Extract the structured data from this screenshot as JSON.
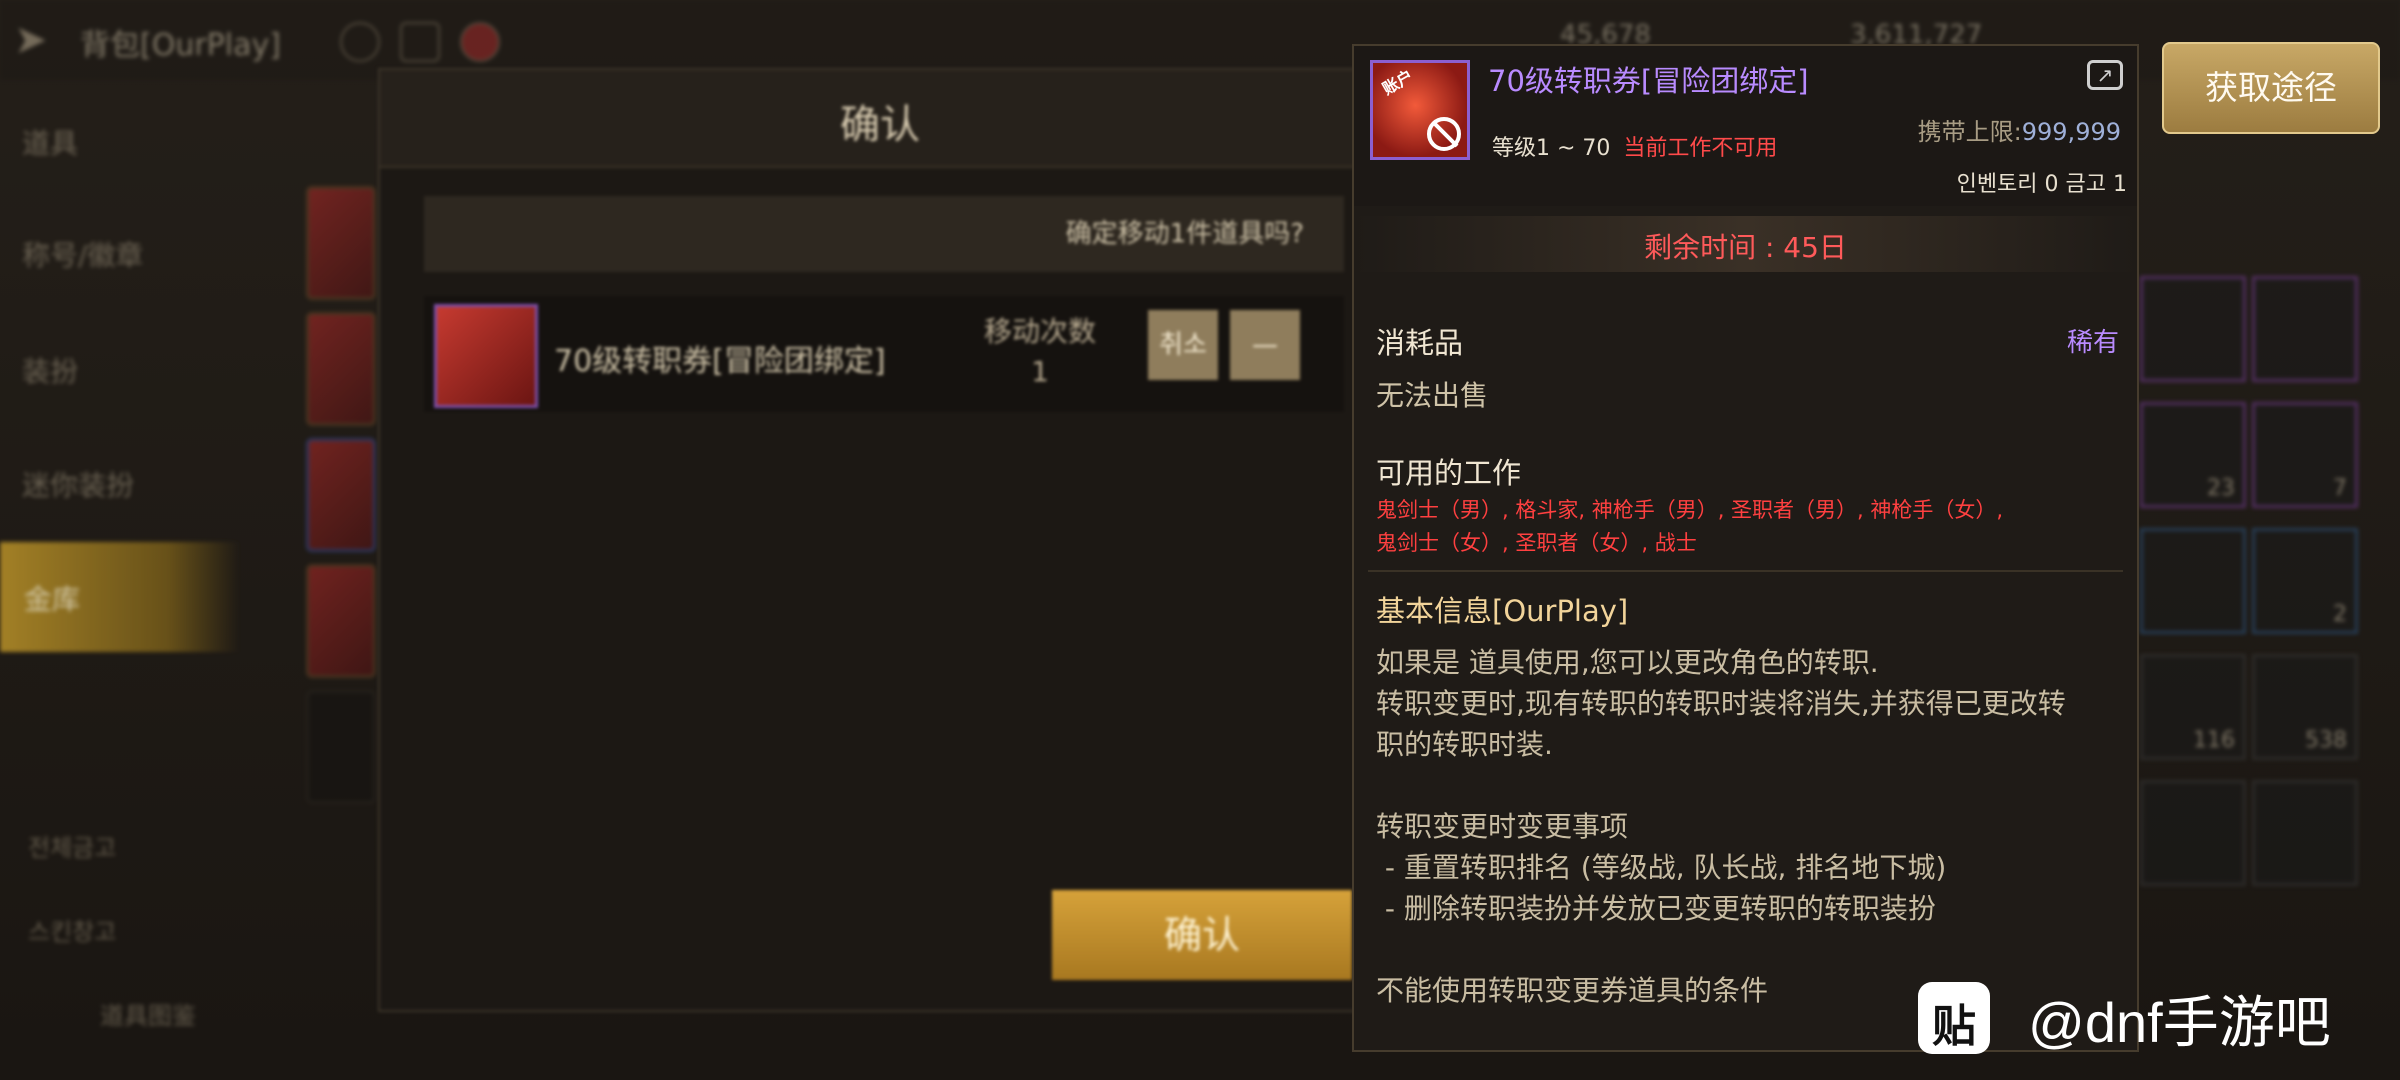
{
  "topbar": {
    "back_icon": "back-arrow-icon",
    "title": "背包[OurPlay]",
    "gold_value": "45,678",
    "cera_value": "3,611,727"
  },
  "sidebar": {
    "items": [
      {
        "label": "道具"
      },
      {
        "label": "称号/徽章"
      },
      {
        "label": "装扮"
      },
      {
        "label": "迷你装扮"
      },
      {
        "label": "金库"
      }
    ],
    "bottom": [
      {
        "label": "전체금고",
        "icon": "vault-icon"
      },
      {
        "label": "스킨창고",
        "icon": "skin-storage-icon"
      },
      {
        "label": "道具图鉴",
        "icon": "codex-icon"
      }
    ]
  },
  "dialog": {
    "title": "确认",
    "question": "确定移动1件道具吗?",
    "item_name": "70级转职券[冒险团绑定]",
    "move_label": "移动次数",
    "move_count": "1",
    "cancel_btn": "취소",
    "minus_btn": "—",
    "confirm_btn": "确认"
  },
  "inventory_counts": [
    "23",
    "7",
    "2",
    "116",
    "538"
  ],
  "tooltip": {
    "item_name": "70级转职券[冒险团绑定]",
    "icon_tag": "账户",
    "level_range": "等级1 ~ 70",
    "job_unavailable": "当前工作不可用",
    "carry_label": "携带上限:",
    "carry_value": "999,999",
    "inventory": "인벤토리 0 금고 1",
    "remaining_time": "剩余时间 : 45日",
    "category": "消耗品",
    "rarity": "稀有",
    "sell": "无法出售",
    "jobs_title": "可用的工作",
    "jobs_line1": "鬼剑士（男）, 格斗家, 神枪手（男）, 圣职者（男）, 神枪手（女）,",
    "jobs_line2": "鬼剑士（女）, 圣职者（女）, 战士",
    "basic_title": "基本信息[OurPlay]",
    "desc_lines": [
      "如果是 道具使用,您可以更改角色的转职.",
      "转职变更时,现有转职的转职时装将消失,并获得已更改转",
      "职的转职时装.",
      "",
      "转职变更时变更事项",
      " - 重置转职排名 (等级战, 队长战, 排名地下城)",
      " - 删除转职装扮并发放已变更转职的转职装扮",
      "",
      "不能使用转职变更券道具的条件"
    ]
  },
  "get_route_btn": "获取途径",
  "watermark": {
    "logo": "贴",
    "text": "@dnf手游吧"
  }
}
